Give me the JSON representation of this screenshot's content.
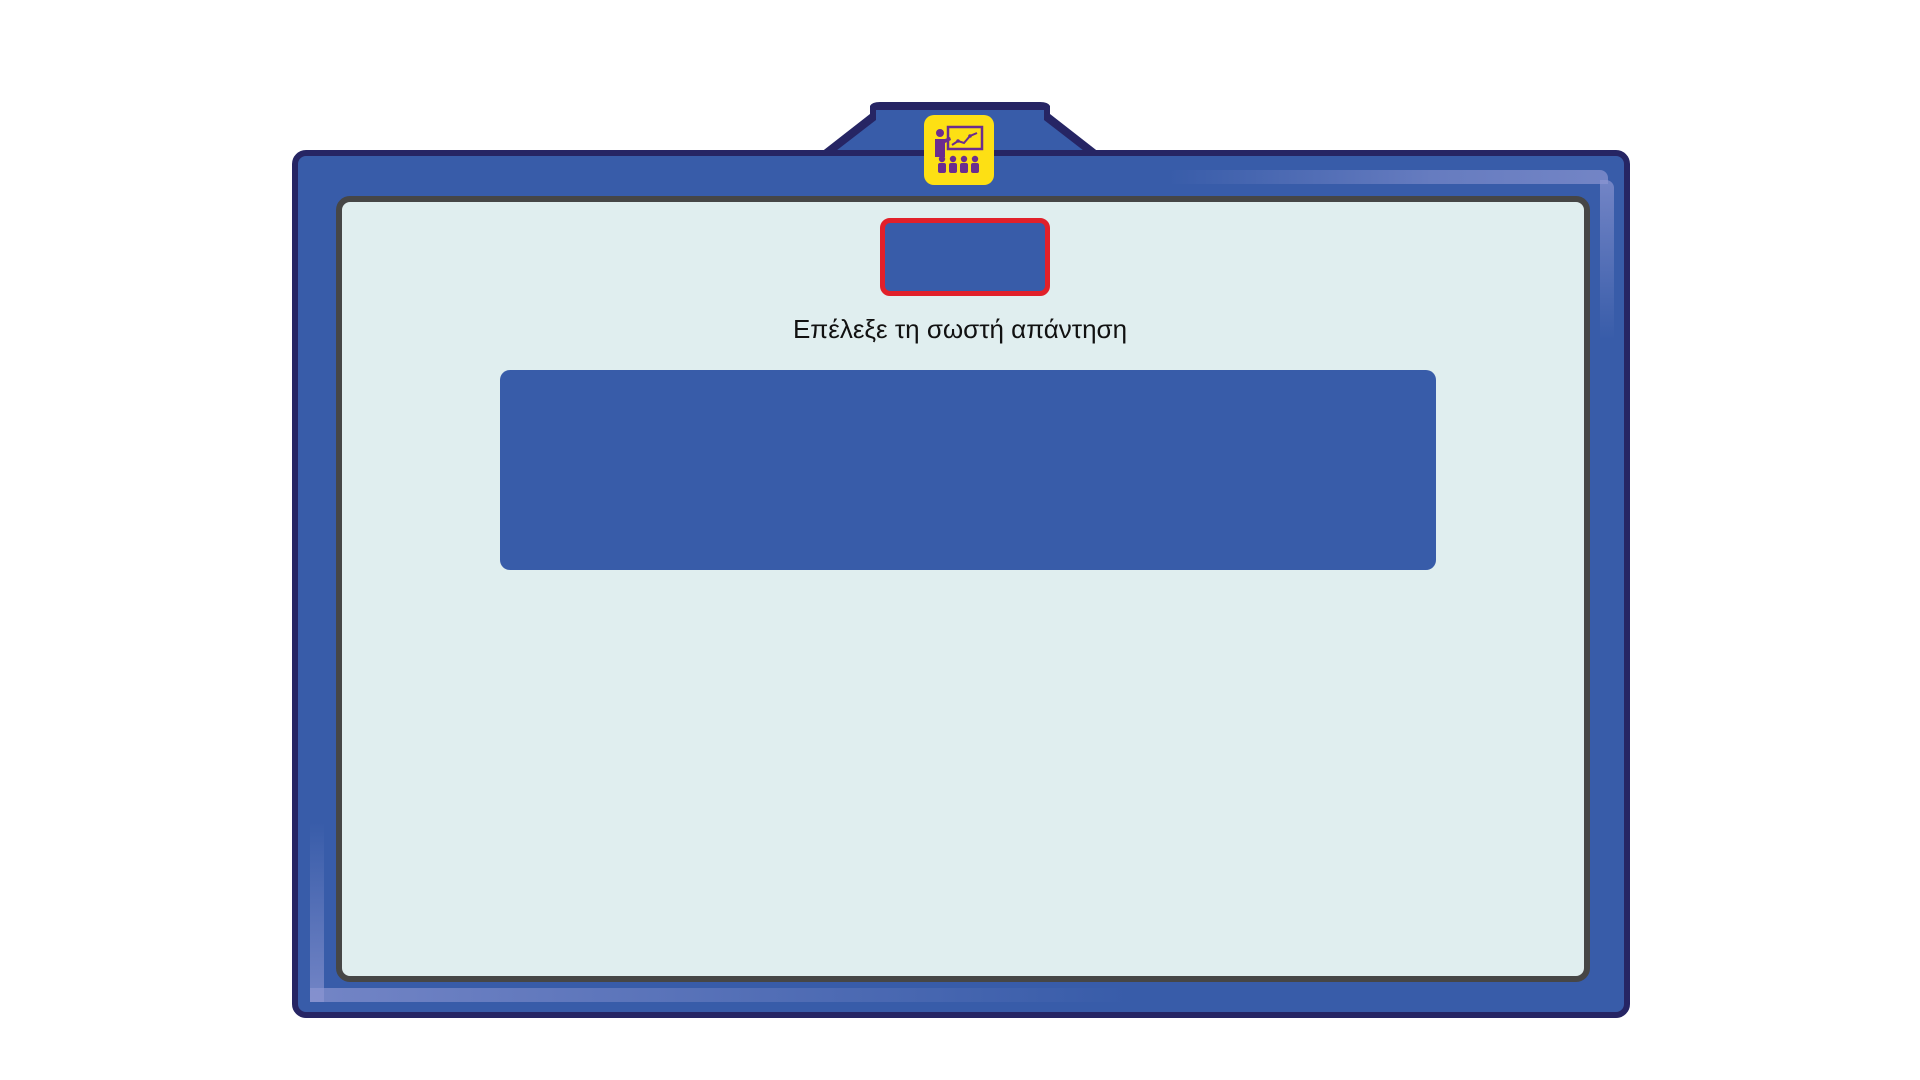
{
  "app": {
    "icon": "presentation-classroom-icon"
  },
  "counter": {
    "text": ""
  },
  "instruction": {
    "text": "Επέλεξε τη σωστή απάντηση"
  },
  "question": {
    "text": ""
  },
  "colors": {
    "frame_blue": "#385ca9",
    "frame_border": "#262564",
    "panel_bg": "#e0eeef",
    "panel_border": "#464646",
    "badge_yellow": "#fde014",
    "counter_border": "#e1202a"
  }
}
